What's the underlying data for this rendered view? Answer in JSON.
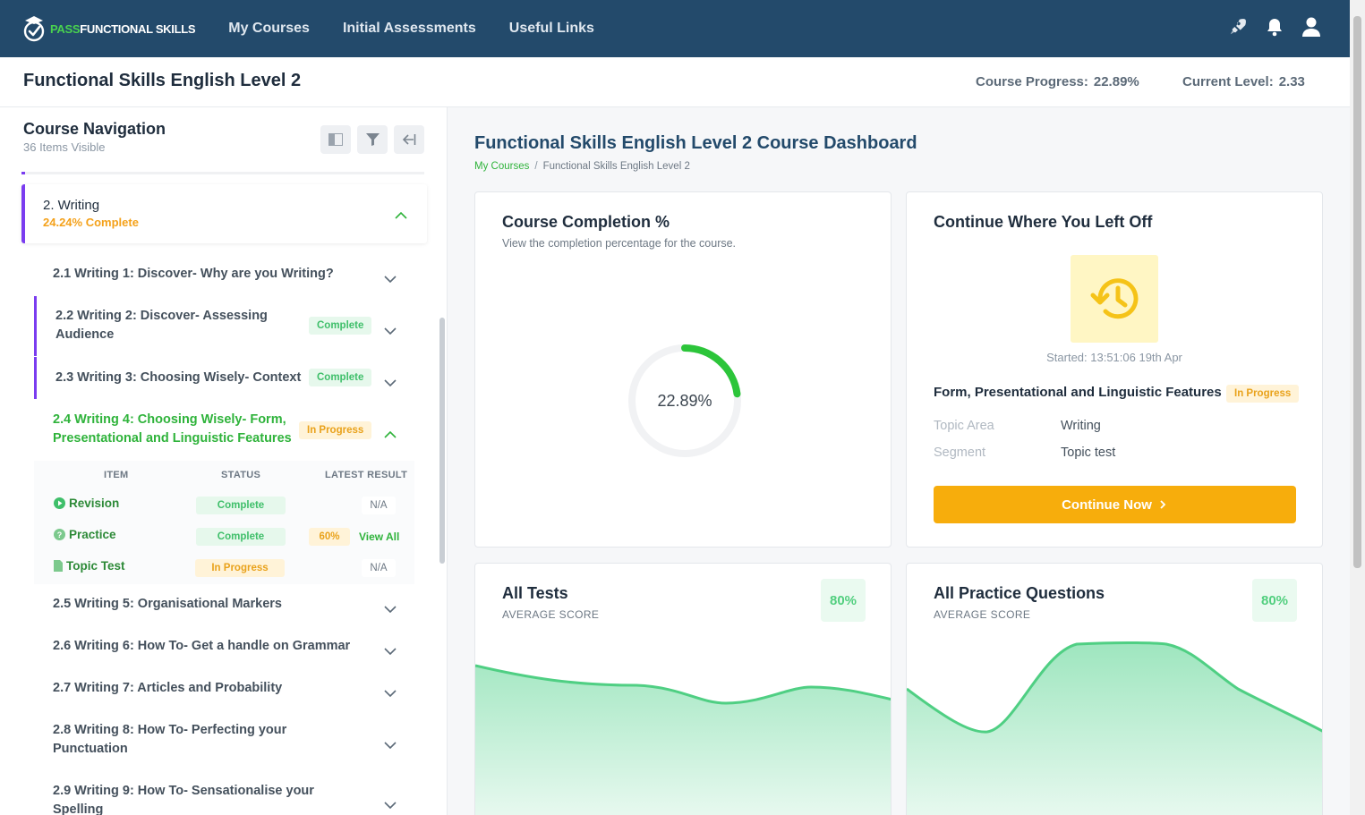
{
  "nav": {
    "brand_pass": "PASS",
    "brand_rest": "FUNCTIONAL SKILLS",
    "links": [
      "My Courses",
      "Initial Assessments",
      "Useful Links"
    ],
    "icons": [
      "rocket-icon",
      "bell-icon",
      "user-icon"
    ],
    "bg_color": "#234a6b"
  },
  "header": {
    "course_title": "Functional Skills English Level 2",
    "progress_label": "Course Progress:",
    "progress_value": "22.89%",
    "level_label": "Current Level:",
    "level_value": "2.33"
  },
  "sidebar": {
    "title": "Course Navigation",
    "subtitle": "36 Items Visible",
    "section": {
      "title": "2. Writing",
      "subtitle": "24.24% Complete"
    },
    "topics": [
      {
        "label": "2.1 Writing 1: Discover- Why are you Writing?",
        "badge": ""
      },
      {
        "label": "2.2 Writing 2: Discover- Assessing Audience",
        "badge": "Complete"
      },
      {
        "label": "2.3 Writing 3: Choosing Wisely- Context",
        "badge": "Complete"
      },
      {
        "label": "2.4 Writing 4: Choosing Wisely- Form, Presentational and Linguistic Features",
        "badge": "In Progress"
      },
      {
        "label": "2.5 Writing 5: Organisational Markers",
        "badge": ""
      },
      {
        "label": "2.6 Writing 6: How To- Get a handle on Grammar",
        "badge": ""
      },
      {
        "label": "2.7 Writing 7: Articles and Probability",
        "badge": ""
      },
      {
        "label": "2.8 Writing 8: How To- Perfecting your Punctuation",
        "badge": ""
      },
      {
        "label": "2.9 Writing 9: How To- Sensationalise your Spelling",
        "badge": ""
      }
    ],
    "detail": {
      "headers": {
        "item": "ITEM",
        "status": "STATUS",
        "result": "LATEST RESULT"
      },
      "rows": [
        {
          "item": "Revision",
          "status": "Complete",
          "result": "N/A"
        },
        {
          "item": "Practice",
          "status": "Complete",
          "score": "60%",
          "result": "View All"
        },
        {
          "item": "Topic Test",
          "status": "In Progress",
          "result": "N/A"
        }
      ]
    }
  },
  "main": {
    "title": "Functional Skills English Level 2 Course Dashboard",
    "breadcrumb": [
      "My Courses",
      "Functional Skills English Level 2"
    ],
    "completion_card": {
      "title": "Course Completion %",
      "subtitle": "View the completion percentage for the course.",
      "percent": 22.89,
      "percent_label": "22.89%"
    },
    "continue_card": {
      "title": "Continue Where You Left Off",
      "started": "Started: 13:51:06 19th Apr",
      "topic": "Form, Presentational and Linguistic Features",
      "badge": "In Progress",
      "topic_area_label": "Topic Area",
      "topic_area_value": "Writing",
      "segment_label": "Segment",
      "segment_value": "Topic test",
      "button": "Continue Now"
    },
    "tests_card": {
      "title": "All Tests",
      "caption": "AVERAGE SCORE",
      "score": "80%"
    },
    "practice_card": {
      "title": "All Practice Questions",
      "caption": "AVERAGE SCORE",
      "score": "80%"
    }
  },
  "colors": {
    "accent_green": "#2fb33b",
    "purple": "#7a3cf0",
    "amber": "#f7ad0c"
  }
}
